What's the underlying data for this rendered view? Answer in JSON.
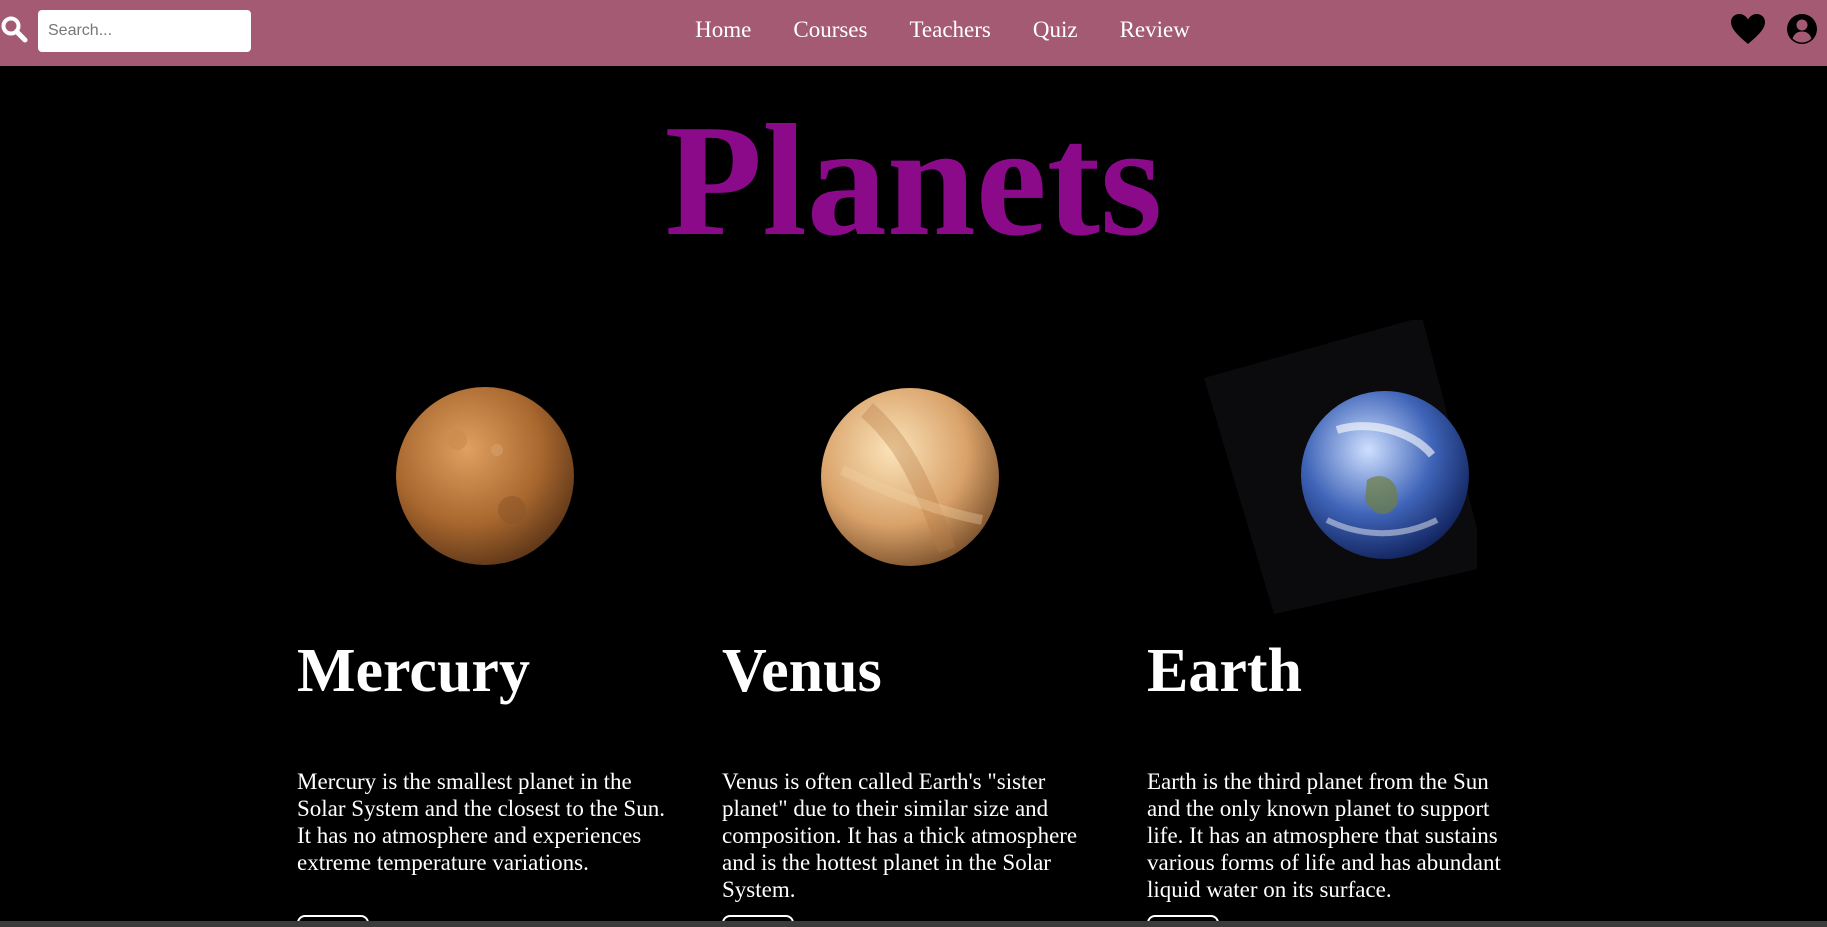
{
  "header": {
    "search_placeholder": "Search...",
    "search_value": "",
    "nav": [
      "Home",
      "Courses",
      "Teachers",
      "Quiz",
      "Review"
    ],
    "icons": {
      "search": "search-icon",
      "favorites": "heart-icon",
      "account": "user-icon"
    },
    "colors": {
      "bar": "#a45a72",
      "link": "#ffffff"
    }
  },
  "hero": {
    "title": "Planets",
    "color": "#8a0a8a"
  },
  "planets": [
    {
      "name": "Mercury",
      "description": "Mercury is the smallest planet in the Solar System and the closest to the Sun. It has no atmosphere and experiences extreme temperature variations.",
      "colors": [
        "#e0a060",
        "#a8672e",
        "#5a3417"
      ]
    },
    {
      "name": "Venus",
      "description": "Venus is often called Earth's \"sister planet\" due to their similar size and composition. It has a thick atmosphere and is the hottest planet in the Solar System.",
      "colors": [
        "#fbe3b8",
        "#d9a26a",
        "#7a4f2a"
      ]
    },
    {
      "name": "Earth",
      "description": "Earth is the third planet from the Sun and the only known planet to support life. It has an atmosphere that sustains various forms of life and has abundant liquid water on its surface.",
      "colors": [
        "#cfe0ff",
        "#3f64b8",
        "#0e1f57"
      ]
    }
  ]
}
